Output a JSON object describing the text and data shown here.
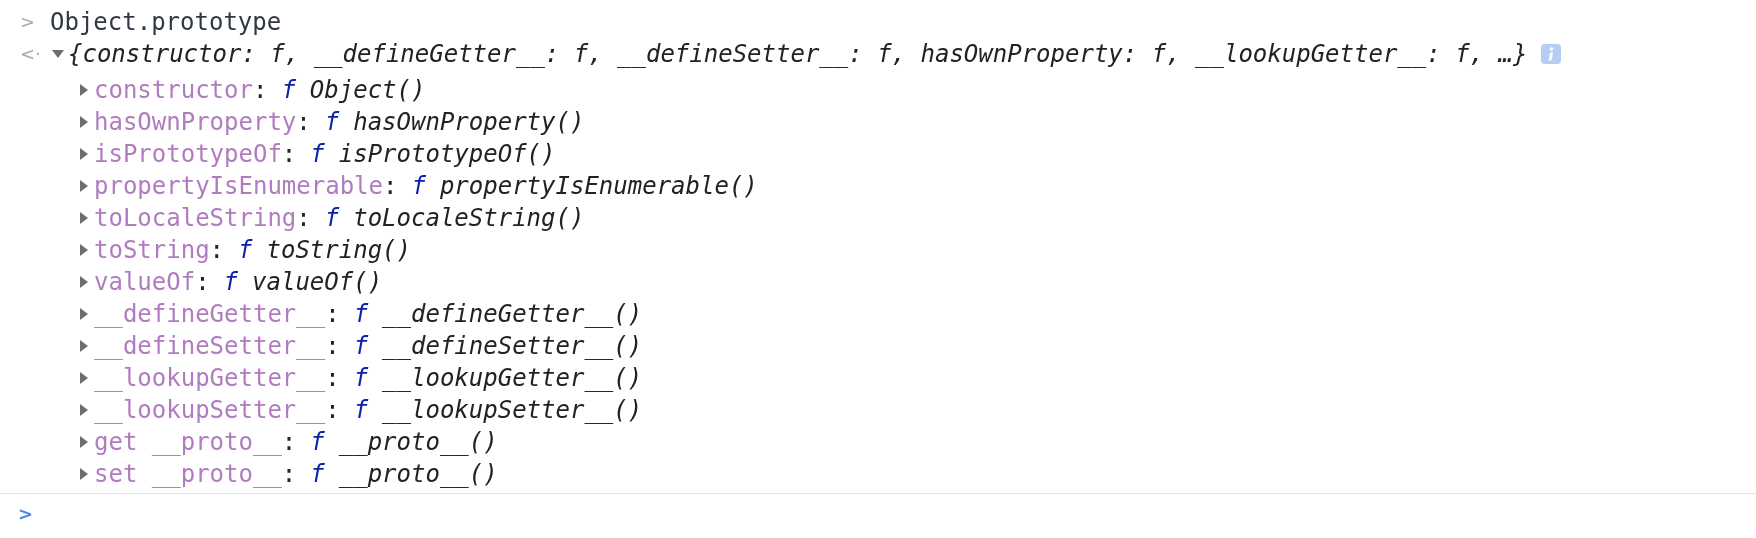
{
  "console": {
    "input": {
      "prompt": ">",
      "text": "Object.prototype"
    },
    "result": {
      "marker": "<·",
      "summary": "{constructor: f, __defineGetter__: f, __defineSetter__: f, hasOwnProperty: f, __lookupGetter__: f, …}",
      "expanded": true,
      "properties": [
        {
          "key": "constructor",
          "separator": ":",
          "type": "f",
          "value": "Object()",
          "expanded": false
        },
        {
          "key": "hasOwnProperty",
          "separator": ":",
          "type": "f",
          "value": "hasOwnProperty()",
          "expanded": false
        },
        {
          "key": "isPrototypeOf",
          "separator": ":",
          "type": "f",
          "value": "isPrototypeOf()",
          "expanded": false
        },
        {
          "key": "propertyIsEnumerable",
          "separator": ":",
          "type": "f",
          "value": "propertyIsEnumerable()",
          "expanded": false
        },
        {
          "key": "toLocaleString",
          "separator": ":",
          "type": "f",
          "value": "toLocaleString()",
          "expanded": false
        },
        {
          "key": "toString",
          "separator": ":",
          "type": "f",
          "value": "toString()",
          "expanded": false
        },
        {
          "key": "valueOf",
          "separator": ":",
          "type": "f",
          "value": "valueOf()",
          "expanded": false
        },
        {
          "key": "__defineGetter__",
          "separator": ":",
          "type": "f",
          "value": "__defineGetter__()",
          "expanded": false
        },
        {
          "key": "__defineSetter__",
          "separator": ":",
          "type": "f",
          "value": "__defineSetter__()",
          "expanded": false
        },
        {
          "key": "__lookupGetter__",
          "separator": ":",
          "type": "f",
          "value": "__lookupGetter__()",
          "expanded": false
        },
        {
          "key": "__lookupSetter__",
          "separator": ":",
          "type": "f",
          "value": "__lookupSetter__()",
          "expanded": false
        },
        {
          "key": "get __proto__",
          "separator": ":",
          "type": "f",
          "value": "__proto__()",
          "expanded": false
        },
        {
          "key": "set __proto__",
          "separator": ":",
          "type": "f",
          "value": "__proto__()",
          "expanded": false
        }
      ]
    },
    "prompt": ">"
  }
}
